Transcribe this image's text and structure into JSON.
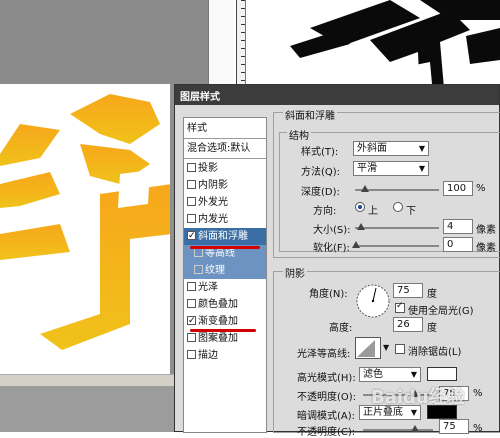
{
  "dialog": {
    "title": "图层样式"
  },
  "left_panel": {
    "header": "样式",
    "blend": "混合选项:默认",
    "items": [
      {
        "label": "投影",
        "checked": false
      },
      {
        "label": "内阴影",
        "checked": false
      },
      {
        "label": "外发光",
        "checked": false
      },
      {
        "label": "内发光",
        "checked": false
      },
      {
        "label": "斜面和浮雕",
        "checked": true,
        "selected": true
      },
      {
        "label": "等高线",
        "checked": false,
        "sub": true
      },
      {
        "label": "纹理",
        "checked": false,
        "sub": true
      },
      {
        "label": "光泽",
        "checked": false
      },
      {
        "label": "颜色叠加",
        "checked": false
      },
      {
        "label": "渐变叠加",
        "checked": true
      },
      {
        "label": "图案叠加",
        "checked": false
      },
      {
        "label": "描边",
        "checked": false
      }
    ]
  },
  "bevel": {
    "section_title": "斜面和浮雕",
    "structure_title": "结构",
    "style_label": "样式(T):",
    "style_value": "外斜面",
    "method_label": "方法(Q):",
    "method_value": "平滑",
    "depth_label": "深度(D):",
    "depth_value": "100",
    "depth_unit": "%",
    "direction_label": "方向:",
    "dir_up": "上",
    "dir_down": "下",
    "size_label": "大小(S):",
    "size_value": "4",
    "size_unit": "像素",
    "soften_label": "软化(F):",
    "soften_value": "0",
    "soften_unit": "像素"
  },
  "shading": {
    "title": "阴影",
    "angle_label": "角度(N):",
    "angle_value": "75",
    "angle_unit": "度",
    "global_light": "使用全局光(G)",
    "altitude_label": "高度:",
    "altitude_value": "26",
    "altitude_unit": "度",
    "gloss_label": "光泽等高线:",
    "antialias": "消除锯齿(L)",
    "highlight_mode_label": "高光模式(H):",
    "highlight_mode_value": "滤色",
    "opacity1_label": "不透明度(O):",
    "opacity1_value": "75",
    "opacity_unit": "%",
    "shadow_mode_label": "暗调模式(A):",
    "shadow_mode_value": "正片叠底",
    "opacity2_label": "不透明度(C):",
    "opacity2_value": "75"
  },
  "watermark": "Baidu经验",
  "colors": {
    "orange_top": "#f7a71b",
    "orange_bottom": "#f08a12",
    "selection": "#3a6ea5",
    "underline": "#d40000"
  }
}
